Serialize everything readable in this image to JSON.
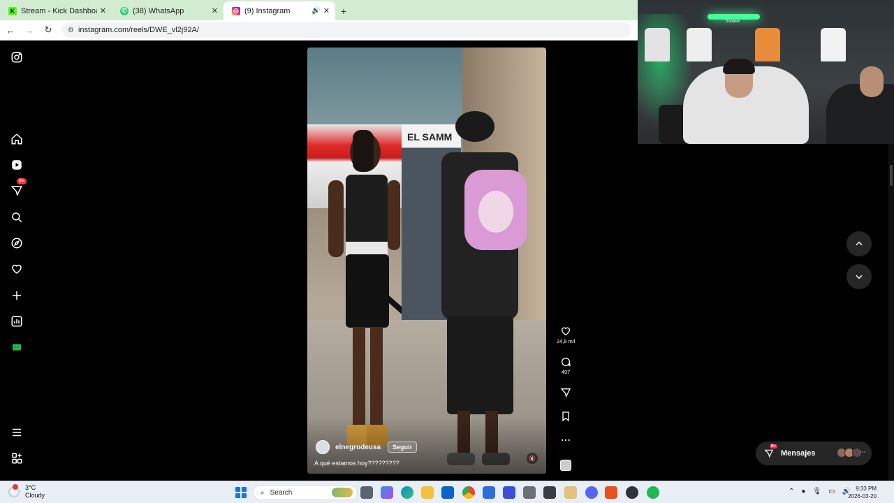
{
  "browser": {
    "tabs": [
      {
        "title": "Stream - Kick Dashboard",
        "favicon": "kick-icon",
        "active": false
      },
      {
        "title": "(38) WhatsApp",
        "favicon": "whatsapp-icon",
        "active": false
      },
      {
        "title": "(9) Instagram",
        "favicon": "instagram-icon",
        "active": true
      }
    ],
    "url": "instagram.com/reels/DWE_vl2j92A/"
  },
  "sidebar": {
    "items": [
      {
        "name": "instagram-logo-icon"
      },
      {
        "name": "home-icon"
      },
      {
        "name": "reels-icon"
      },
      {
        "name": "messages-icon",
        "badge": "9+"
      },
      {
        "name": "search-icon"
      },
      {
        "name": "explore-icon"
      },
      {
        "name": "notifications-heart-icon"
      },
      {
        "name": "create-plus-icon"
      },
      {
        "name": "dashboard-icon"
      },
      {
        "name": "profile-icon"
      },
      {
        "name": "more-menu-icon"
      },
      {
        "name": "also-from-meta-icon"
      }
    ]
  },
  "reel": {
    "sign_text": "EL SAMM",
    "author": "elnegrodeusa",
    "follow_label": "Seguir",
    "caption": "A qué estamos hoy?????????",
    "likes": "24,8 mil",
    "comments": "497"
  },
  "messages": {
    "label": "Mensajes",
    "badge": "9+"
  },
  "webcam": {
    "sign": "Tovarex"
  },
  "taskbar": {
    "weather_temp": "3°C",
    "weather_desc": "Cloudy",
    "search_label": "Search",
    "time": "9:33 PM",
    "date": "2026-03-20"
  },
  "colors": {
    "tabbar_bg": "#d3ecd1",
    "instagram_bg": "#000000",
    "badge_red": "#ff3040",
    "taskbar_bg": "#e8eef5"
  }
}
